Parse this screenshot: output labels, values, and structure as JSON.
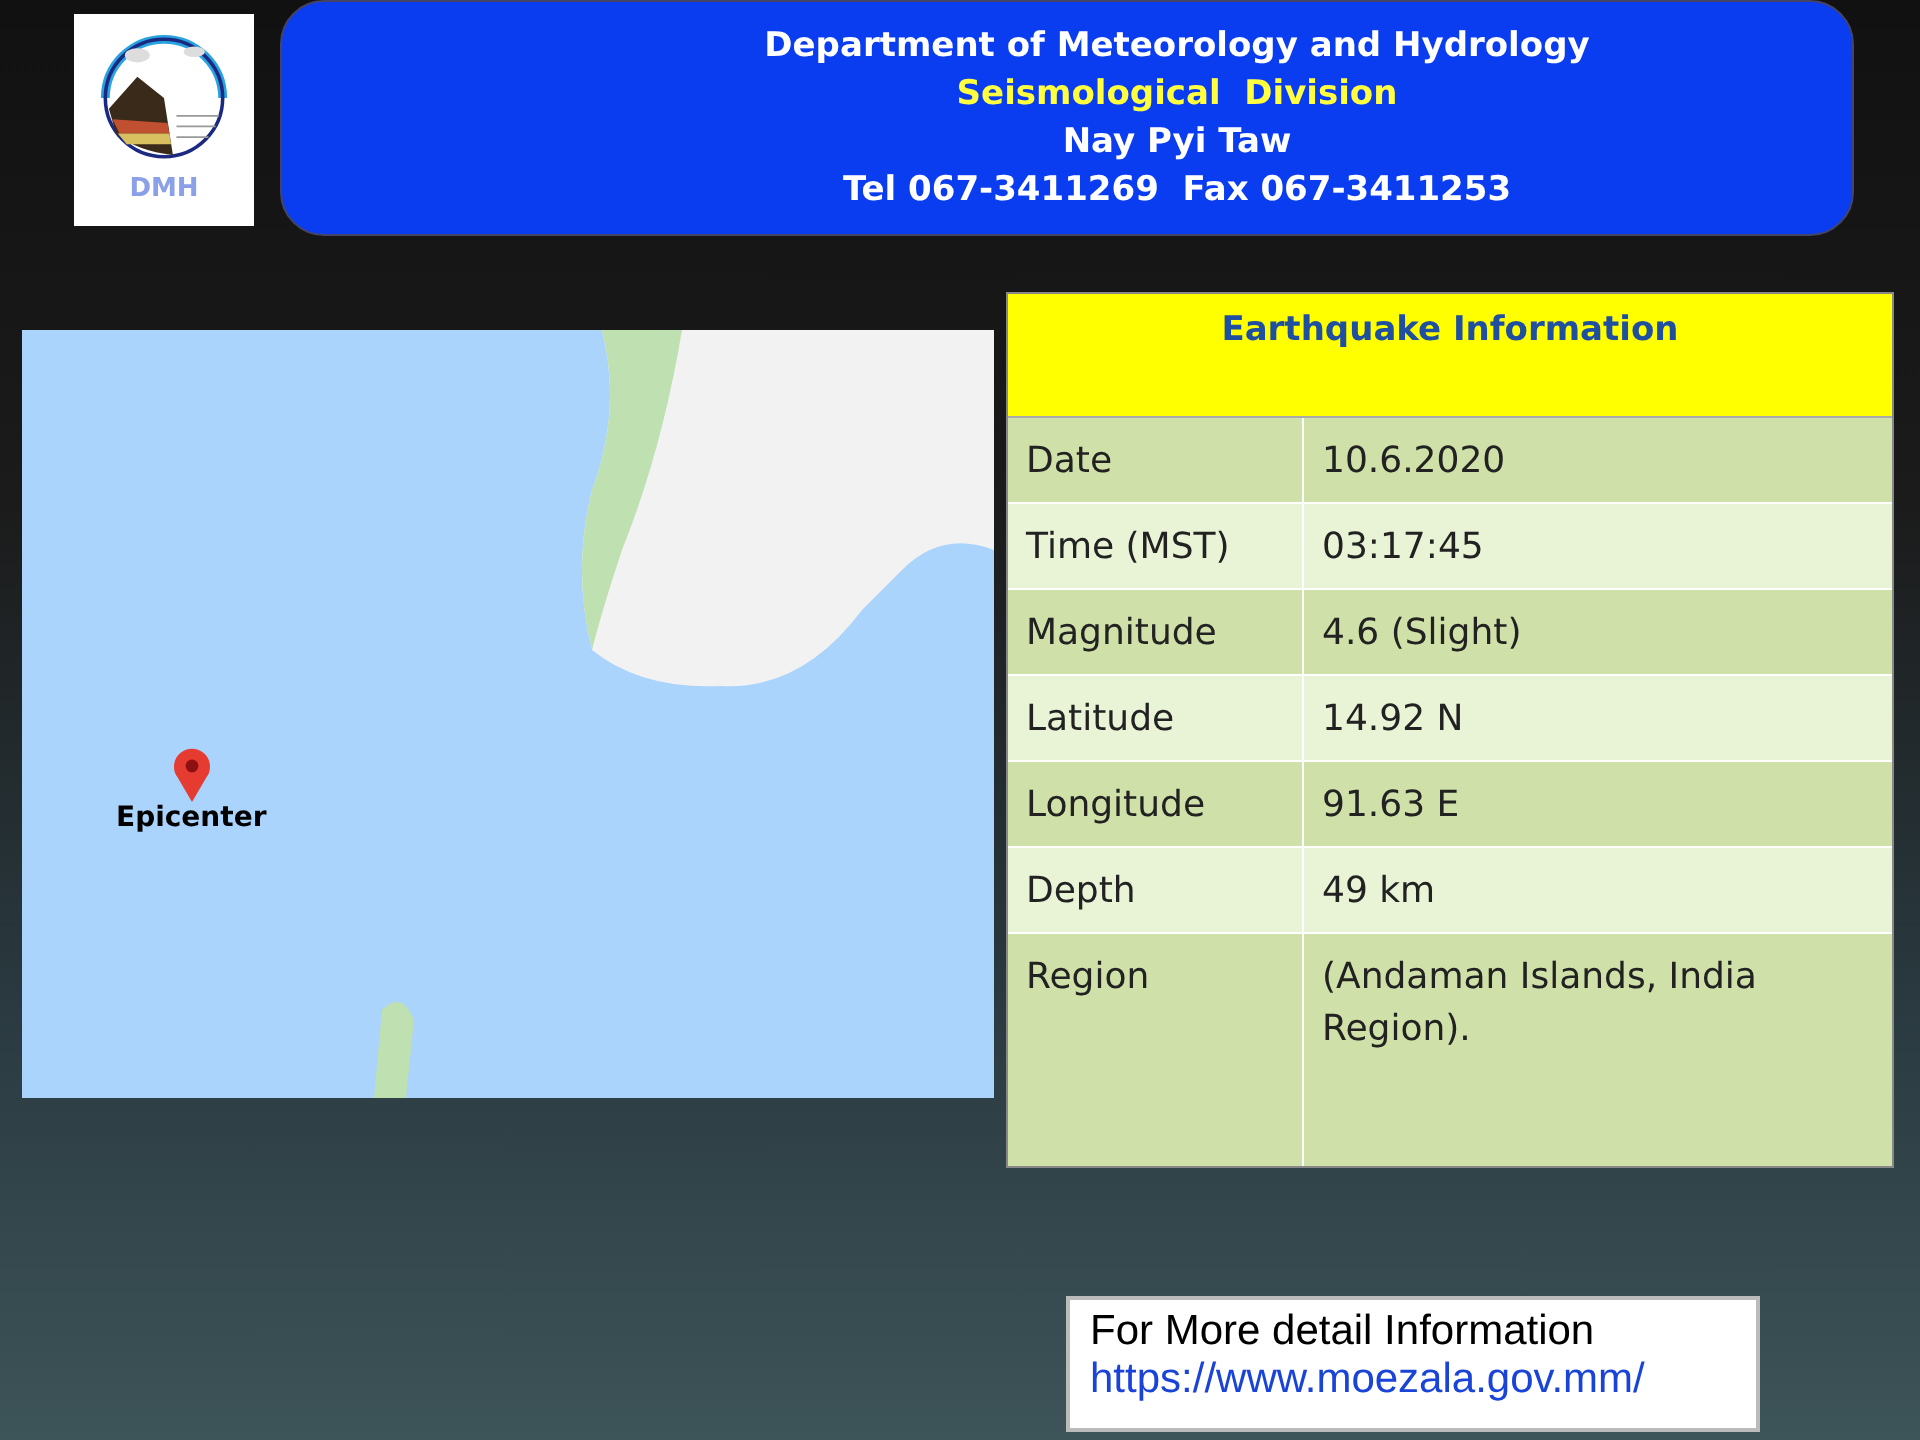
{
  "header": {
    "logo_text": "DMH",
    "lines": [
      {
        "text": "Department of Meteorology and Hydrology",
        "kind": "plain"
      },
      {
        "text": "Seismological  Division",
        "kind": "highlight"
      },
      {
        "text": "Nay Pyi Taw",
        "kind": "plain"
      },
      {
        "text": "Tel 067-3411269  Fax 067-3411253",
        "kind": "plain"
      }
    ]
  },
  "map": {
    "marker_label": "Epicenter"
  },
  "info_table": {
    "title": "Earthquake Information",
    "rows": [
      {
        "label": "Date",
        "value": "10.6.2020"
      },
      {
        "label": "Time (MST)",
        "value": "03:17:45"
      },
      {
        "label": "Magnitude",
        "value": "4.6 (Slight)"
      },
      {
        "label": "Latitude",
        "value": "14.92 N"
      },
      {
        "label": "Longitude",
        "value": "91.63 E"
      },
      {
        "label": "Depth",
        "value": "49 km"
      },
      {
        "label": "Region",
        "value": "(Andaman Islands, India Region)."
      }
    ]
  },
  "footer": {
    "text": "For More detail Information",
    "link": "https://www.moezala.gov.mm/"
  }
}
